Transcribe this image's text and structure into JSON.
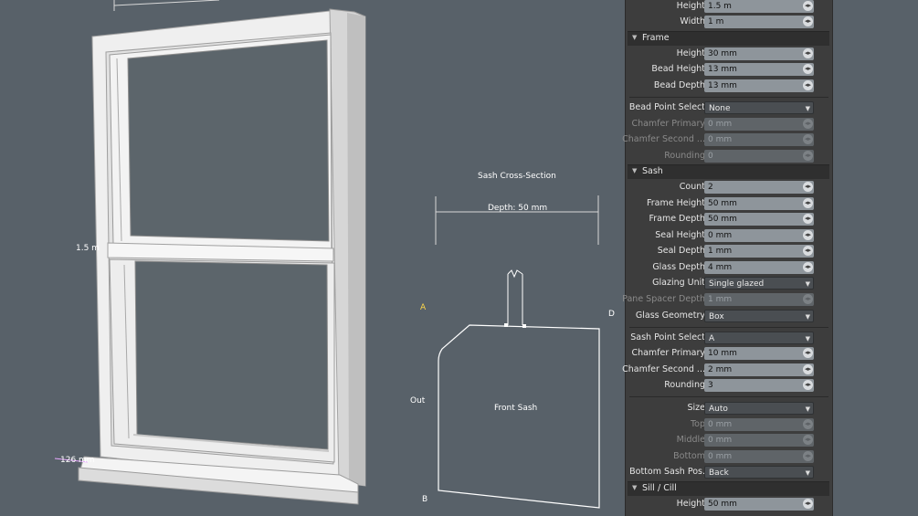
{
  "viewport": {
    "cross_section_title": "Sash Cross-Section",
    "depth_label": "Depth: 50 mm",
    "front_sash_label": "Front Sash",
    "out_label": "Out",
    "height_dim": "1.5 m",
    "sill_dim": "126 mm",
    "corners": {
      "a": "A",
      "b": "B",
      "d": "D"
    }
  },
  "panel": {
    "top_rows": [
      {
        "label": "Height",
        "value": "1.5 m"
      },
      {
        "label": "Width",
        "value": "1 m"
      }
    ],
    "frame": {
      "title": "Frame",
      "rows": [
        {
          "label": "Height",
          "value": "30 mm"
        },
        {
          "label": "Bead Height",
          "value": "13 mm"
        },
        {
          "label": "Bead Depth",
          "value": "13 mm"
        }
      ],
      "bead_point_select": {
        "label": "Bead Point Select",
        "value": "None"
      },
      "disabled_rows": [
        {
          "label": "Chamfer Primary",
          "value": "0 mm"
        },
        {
          "label": "Chamfer Second ...",
          "value": "0 mm"
        },
        {
          "label": "Rounding",
          "value": "0"
        }
      ]
    },
    "sash": {
      "title": "Sash",
      "rows": [
        {
          "label": "Count",
          "value": "2"
        },
        {
          "label": "Frame Height",
          "value": "50 mm"
        },
        {
          "label": "Frame Depth",
          "value": "50 mm"
        },
        {
          "label": "Seal Height",
          "value": "0 mm"
        },
        {
          "label": "Seal Depth",
          "value": "1 mm"
        },
        {
          "label": "Glass Depth",
          "value": "4 mm"
        }
      ],
      "glazing_unit": {
        "label": "Glazing Unit",
        "value": "Single glazed"
      },
      "pane_spacer_depth": {
        "label": "Pane Spacer Depth",
        "value": "1 mm"
      },
      "glass_geometry": {
        "label": "Glass Geometry",
        "value": "Box"
      },
      "sash_point_select": {
        "label": "Sash Point Select",
        "value": "A"
      },
      "point_rows": [
        {
          "label": "Chamfer Primary",
          "value": "10 mm"
        },
        {
          "label": "Chamfer Second ...",
          "value": "2 mm"
        },
        {
          "label": "Rounding",
          "value": "3"
        }
      ],
      "size": {
        "label": "Size",
        "value": "Auto"
      },
      "disabled_size_rows": [
        {
          "label": "Top",
          "value": "0 mm"
        },
        {
          "label": "Middle",
          "value": "0 mm"
        },
        {
          "label": "Bottom",
          "value": "0 mm"
        }
      ],
      "bottom_sash_pos": {
        "label": "Bottom Sash Pos.",
        "value": "Back"
      }
    },
    "sill": {
      "title": "Sill / Cill",
      "rows": [
        {
          "label": "Height",
          "value": "50 mm"
        }
      ]
    }
  }
}
